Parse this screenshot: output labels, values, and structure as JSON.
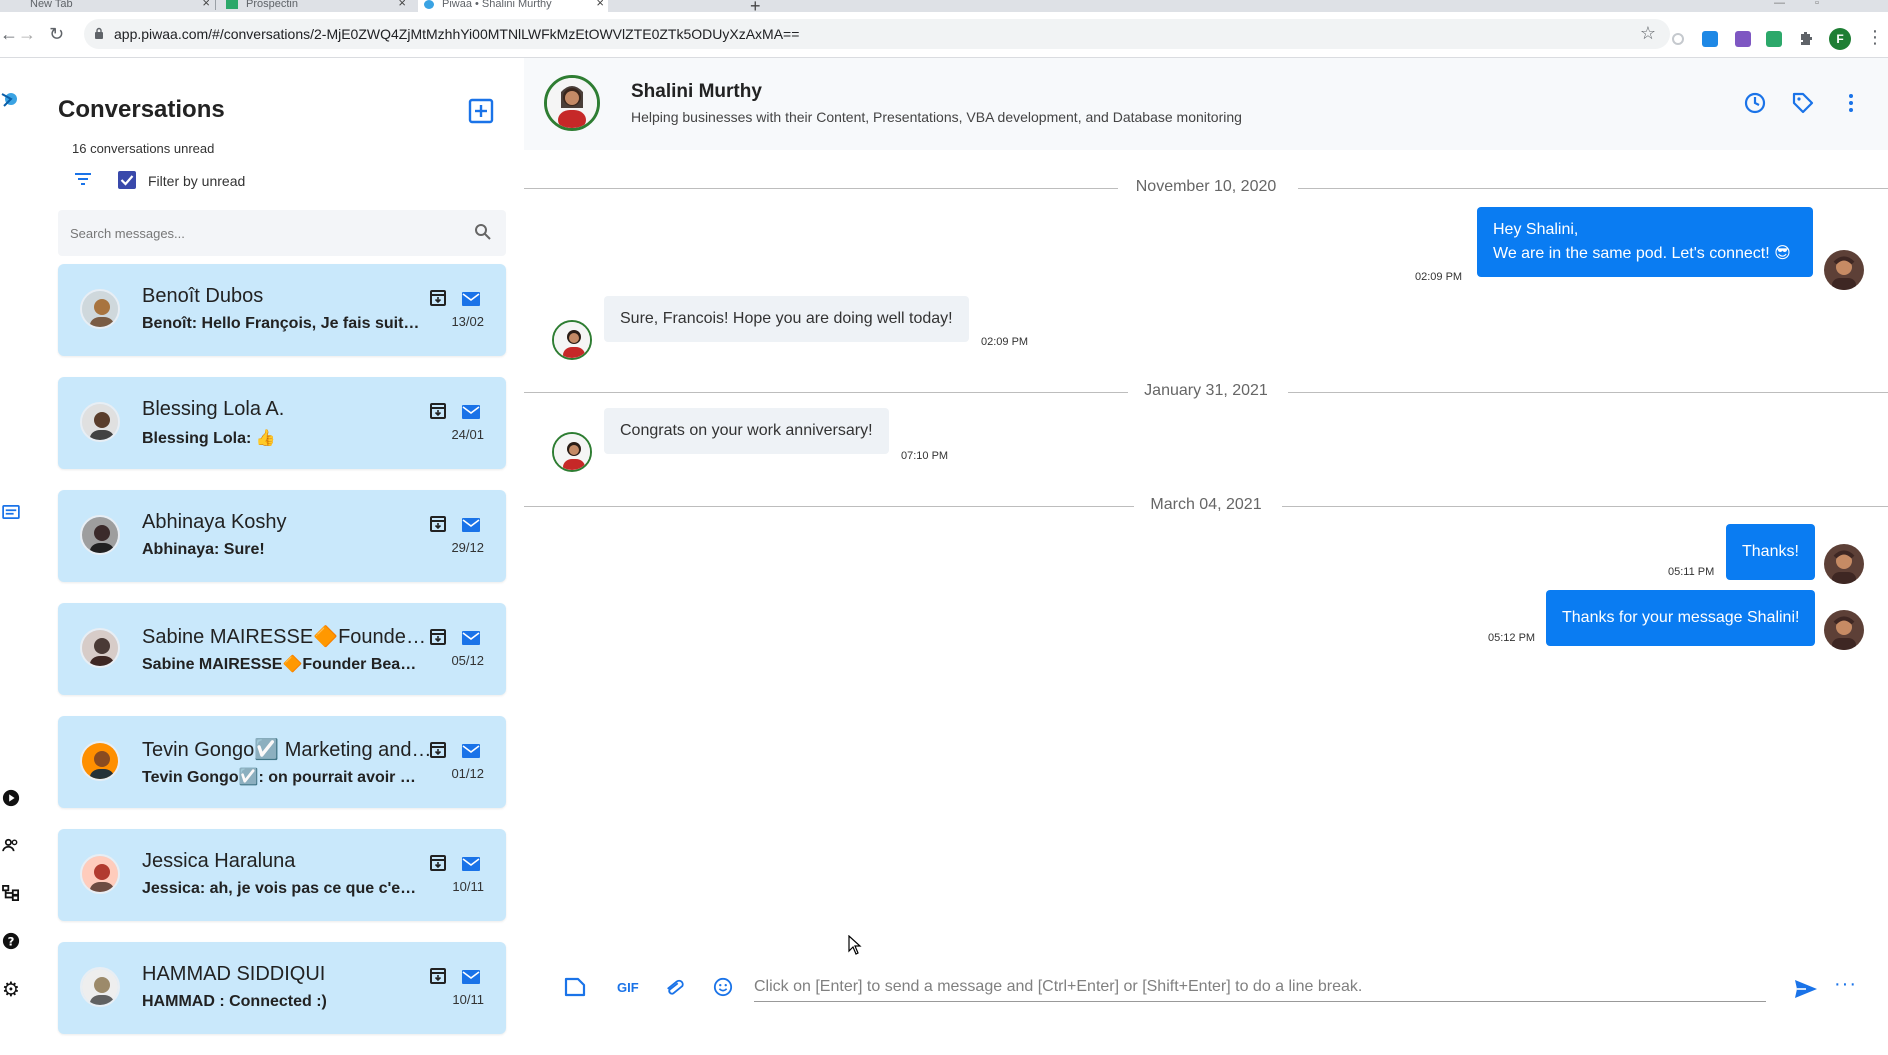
{
  "browser": {
    "tabs": [
      {
        "label": "New Tab",
        "active": false
      },
      {
        "label": "Prospectin",
        "active": false
      },
      {
        "label": "Piwaa • Shalini Murthy",
        "active": true
      }
    ],
    "url": "app.piwaa.com/#/conversations/2-MjE0ZWQ4ZjMtMzhhYi00MTNlLWFkMzEtOWVlZTE0ZTk5ODUyXzAxMA==",
    "profile_initial": "F"
  },
  "conversations": {
    "title": "Conversations",
    "unread_count": "16 conversations unread",
    "filter_label": "Filter by unread",
    "filter_checked": true,
    "search_placeholder": "Search messages...",
    "items": [
      {
        "name": "Benoît Dubos",
        "preview": "Benoît: Hello François, Je fais suite à notre échange",
        "date": "13/02",
        "avatar_color": "#a8743f"
      },
      {
        "name": "Blessing Lola A.",
        "preview": "Blessing Lola: 👍",
        "date": "24/01",
        "avatar_color": "#5a3d2b"
      },
      {
        "name": "Abhinaya Koshy",
        "preview": "Abhinaya: Sure!",
        "date": "29/12",
        "avatar_color": "#3b2a2a"
      },
      {
        "name": "Sabine MAIRESSE🔶Founder Beauty",
        "preview": "Sabine MAIRESSE🔶Founder Beauté",
        "date": "05/12",
        "avatar_color": "#4a3a36"
      },
      {
        "name": "Tevin Gongo☑️ Marketing and Sales",
        "preview": "Tevin Gongo☑️: on pourrait avoir un échange",
        "date": "01/12",
        "avatar_color": "#8a4b20"
      },
      {
        "name": "Jessica Haraluna",
        "preview": "Jessica: ah, je vois pas ce que c'est exactement",
        "date": "10/11",
        "avatar_color": "#b23b2f"
      },
      {
        "name": "HAMMAD SIDDIQUI",
        "preview": "HAMMAD : Connected :)",
        "date": "10/11",
        "avatar_color": "#9c8a6a"
      }
    ]
  },
  "chat": {
    "contact_name": "Shalini Murthy",
    "contact_headline": "Helping businesses with their Content, Presentations, VBA development, and Database monitoring",
    "date_separators": [
      "November 10, 2020",
      "January 31, 2021",
      "March 04, 2021"
    ],
    "messages": [
      {
        "direction": "out",
        "lines": [
          "Hey Shalini,",
          "We are in the same pod. Let's connect! 😎"
        ],
        "time": "02:09 PM"
      },
      {
        "direction": "in",
        "lines": [
          "Sure, Francois! Hope you are doing well today!"
        ],
        "time": "02:09 PM"
      },
      {
        "direction": "in",
        "lines": [
          "Congrats on your work anniversary!"
        ],
        "time": "07:10 PM"
      },
      {
        "direction": "out",
        "lines": [
          "Thanks!"
        ],
        "time": "05:11 PM"
      },
      {
        "direction": "out",
        "lines": [
          "Thanks for your message Shalini!"
        ],
        "time": "05:12 PM"
      }
    ],
    "composer": {
      "gif_label": "GIF",
      "placeholder": "Click on [Enter] to send a message and [Ctrl+Enter] or [Shift+Enter] to do a line break.",
      "more": "···"
    }
  },
  "colors": {
    "accent": "#0a7cf2",
    "conv_card": "#c9e8fb",
    "checkbox": "#3949ab",
    "icon_blue": "#1a73e8"
  }
}
